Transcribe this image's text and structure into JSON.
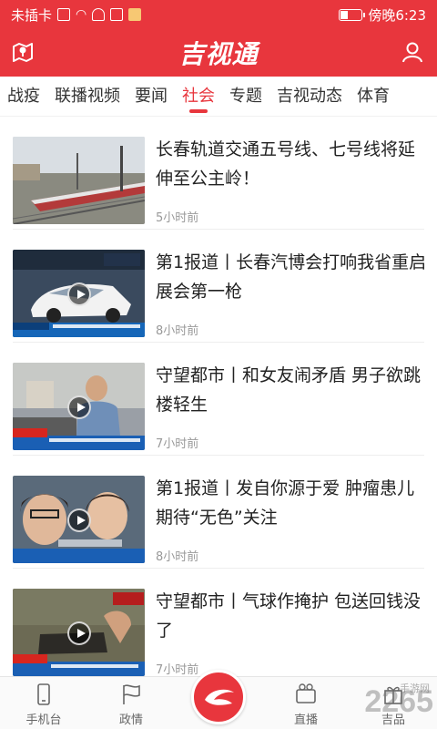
{
  "status_bar": {
    "carrier": "未插卡",
    "time": "傍晚6:23",
    "battery_level": 0.35
  },
  "header": {
    "logo_text": "吉视通",
    "left_icon": "map-pin-icon",
    "right_icon": "user-icon"
  },
  "tabs": [
    {
      "label": "战疫",
      "active": false
    },
    {
      "label": "联播视频",
      "active": false
    },
    {
      "label": "要闻",
      "active": false
    },
    {
      "label": "社会",
      "active": true
    },
    {
      "label": "专题",
      "active": false
    },
    {
      "label": "吉视动态",
      "active": false
    },
    {
      "label": "体育",
      "active": false
    }
  ],
  "feed": [
    {
      "title": "长春轨道交通五号线、七号线将延伸至公主岭！",
      "time": "5小时前",
      "video": false
    },
    {
      "title": "第1报道丨长春汽博会打响我省重启展会第一枪",
      "time": "8小时前",
      "video": true
    },
    {
      "title": "守望都市丨和女友闹矛盾 男子欲跳楼轻生",
      "time": "7小时前",
      "video": true
    },
    {
      "title": "第1报道丨发自你源于爱 肿瘤患儿期待“无色”关注",
      "time": "8小时前",
      "video": true
    },
    {
      "title": "守望都市丨气球作掩护 包送回钱没了",
      "time": "7小时前",
      "video": true
    }
  ],
  "tabbar": {
    "items": [
      {
        "label": "手机台",
        "icon": "phone-icon"
      },
      {
        "label": "政情",
        "icon": "flag-icon"
      },
      {
        "label": "直播",
        "icon": "tv-icon"
      },
      {
        "label": "吉品",
        "icon": "gift-icon"
      }
    ],
    "center_icon": "brand-swoosh-icon"
  },
  "watermark": {
    "main": "2265",
    "sub": "手游网"
  },
  "colors": {
    "brand_red": "#e8363d",
    "text_primary": "#222222",
    "text_secondary": "#999999"
  }
}
